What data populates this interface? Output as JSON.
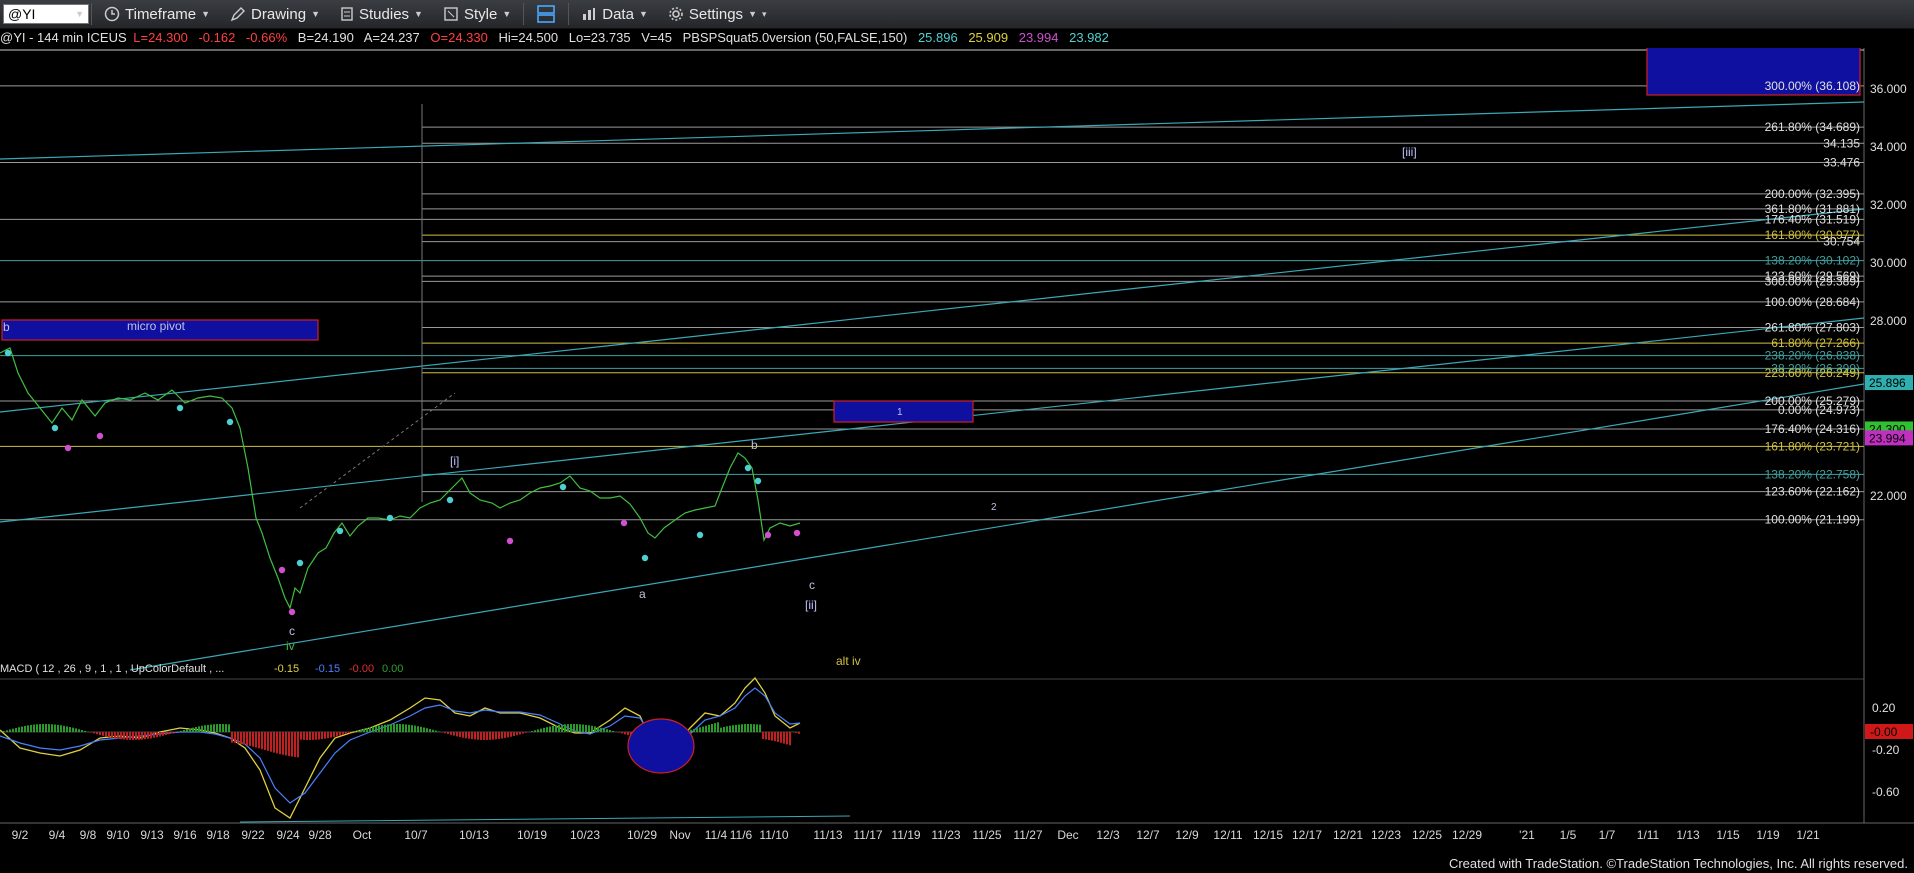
{
  "toolbar": {
    "symbol": "@YI",
    "timeframe": "Timeframe",
    "drawing": "Drawing",
    "studies": "Studies",
    "style": "Style",
    "data": "Data",
    "settings": "Settings"
  },
  "info": {
    "symbol_desc": "@YI - 144 min  ICEUS",
    "last": "L=24.300",
    "change": "-0.162",
    "change_pct": "-0.66%",
    "bid": "B=24.190",
    "ask": "A=24.237",
    "open": "O=24.330",
    "high": "Hi=24.500",
    "low": "Lo=23.735",
    "volume": "V=45",
    "study": "PBSPSquat5.0version (50,FALSE,150)",
    "study_values": [
      "25.896",
      "25.909",
      "23.994",
      "23.982"
    ],
    "study_colors": [
      "#4fd0d0",
      "#e0d040",
      "#d050d0",
      "#4fd0d0"
    ]
  },
  "price_axis": [
    "36.000",
    "34.000",
    "32.000",
    "30.000",
    "28.000",
    "22.000"
  ],
  "fib_labels": [
    {
      "text": "300.00% (36.108)",
      "price": 36.108,
      "color": "#e0e0e0"
    },
    {
      "text": "261.80% (34.689)",
      "price": 34.689,
      "color": "#e0e0e0"
    },
    {
      "text": "34.135",
      "price": 34.135,
      "color": "#e0e0e0"
    },
    {
      "text": "33.476",
      "price": 33.476,
      "color": "#e0e0e0"
    },
    {
      "text": "200.00% (32.395)",
      "price": 32.395,
      "color": "#e0e0e0"
    },
    {
      "text": "361.80% (31.881)",
      "price": 31.881,
      "color": "#e0e0e0"
    },
    {
      "text": "176.40% (31.519)",
      "price": 31.519,
      "color": "#e0e0e0"
    },
    {
      "text": "161.80% (30.977)",
      "price": 30.977,
      "color": "#d0c040"
    },
    {
      "text": "30.754",
      "price": 30.754,
      "color": "#e0e0e0"
    },
    {
      "text": "138.20% (30.102)",
      "price": 30.102,
      "color": "#40a0a0"
    },
    {
      "text": "123.60% (29.569)",
      "price": 29.569,
      "color": "#e0e0e0"
    },
    {
      "text": "300.00% (29.389)",
      "price": 29.389,
      "color": "#e0e0e0"
    },
    {
      "text": "100.00% (28.684)",
      "price": 28.684,
      "color": "#e0e0e0"
    },
    {
      "text": "261.80% (27.803)",
      "price": 27.803,
      "color": "#e0e0e0"
    },
    {
      "text": "61.80% (27.266)",
      "price": 27.266,
      "color": "#d0c040"
    },
    {
      "text": "238.20% (26.838)",
      "price": 26.838,
      "color": "#40a0a0"
    },
    {
      "text": "38.20% (26.399)",
      "price": 26.399,
      "color": "#40a0a0"
    },
    {
      "text": "223.60% (26.249)",
      "price": 26.249,
      "color": "#d0c040"
    },
    {
      "text": "200.00% (25.279)",
      "price": 25.279,
      "color": "#e0e0e0"
    },
    {
      "text": "0.00% (24.973)",
      "price": 24.973,
      "color": "#e0e0e0"
    },
    {
      "text": "176.40% (24.316)",
      "price": 24.316,
      "color": "#e0e0e0"
    },
    {
      "text": "161.80% (23.721)",
      "price": 23.721,
      "color": "#d0c040"
    },
    {
      "text": "138.20% (22.758)",
      "price": 22.758,
      "color": "#40a0a0"
    },
    {
      "text": "123.60% (22.162)",
      "price": 22.162,
      "color": "#e0e0e0"
    },
    {
      "text": "100.00% (21.199)",
      "price": 21.199,
      "color": "#e0e0e0"
    }
  ],
  "price_tags": [
    {
      "text": "25.896",
      "price": 25.896,
      "bg": "#2fb0b0",
      "fg": "#000"
    },
    {
      "text": "24.300",
      "price": 24.3,
      "bg": "#30c030",
      "fg": "#000"
    },
    {
      "text": "23.994",
      "price": 23.994,
      "bg": "#c030c0",
      "fg": "#000"
    }
  ],
  "wave_labels": [
    {
      "text": "b",
      "color": "#c0c0e0"
    },
    {
      "text": "micro pivot",
      "color": "#c0c0e0"
    },
    {
      "text": "[i]",
      "color": "#c0c0ff"
    },
    {
      "text": "b",
      "color": "#c0c0e0"
    },
    {
      "text": "a",
      "color": "#c0c0e0"
    },
    {
      "text": "c",
      "color": "#c0c0e0"
    },
    {
      "text": "[ii]",
      "color": "#c0c0ff"
    },
    {
      "text": "c",
      "color": "#c0c0e0"
    },
    {
      "text": "iv",
      "color": "#40c040"
    },
    {
      "text": "alt iv",
      "color": "#d0c040"
    },
    {
      "text": "1",
      "color": "#c0c0ff"
    },
    {
      "text": "2",
      "color": "#c0c0e0"
    },
    {
      "text": "[iii]",
      "color": "#c0c0ff"
    }
  ],
  "macd": {
    "label": "MACD ( 12 , 26 , 9 , 1 , 1 , UpColorDefault , ...",
    "values": [
      {
        "text": "-0.15",
        "color": "#e0d040"
      },
      {
        "text": "-0.15",
        "color": "#4a80ff"
      },
      {
        "text": "-0.00",
        "color": "#e03030"
      },
      {
        "text": "0.00",
        "color": "#30a030"
      }
    ],
    "axis": [
      "0.20",
      "-0.20",
      "-0.60"
    ],
    "tag": "-0.00"
  },
  "date_axis": [
    "9/2",
    "9/4",
    "9/8",
    "9/10",
    "9/13",
    "9/16",
    "9/18",
    "9/22",
    "9/24",
    "9/28",
    "Oct",
    "10/7",
    "10/13",
    "10/19",
    "10/23",
    "10/29",
    "Nov",
    "11/4",
    "11/6",
    "11/10",
    "11/13",
    "11/17",
    "11/19",
    "11/23",
    "11/25",
    "11/27",
    "Dec",
    "12/3",
    "12/7",
    "12/9",
    "12/11",
    "12/15",
    "12/17",
    "12/21",
    "12/23",
    "12/25",
    "12/29",
    "'21",
    "1/5",
    "1/7",
    "1/11",
    "1/13",
    "1/15",
    "1/19",
    "1/21"
  ],
  "footer": "Created with TradeStation. ©TradeStation Technologies, Inc. All rights reserved."
}
